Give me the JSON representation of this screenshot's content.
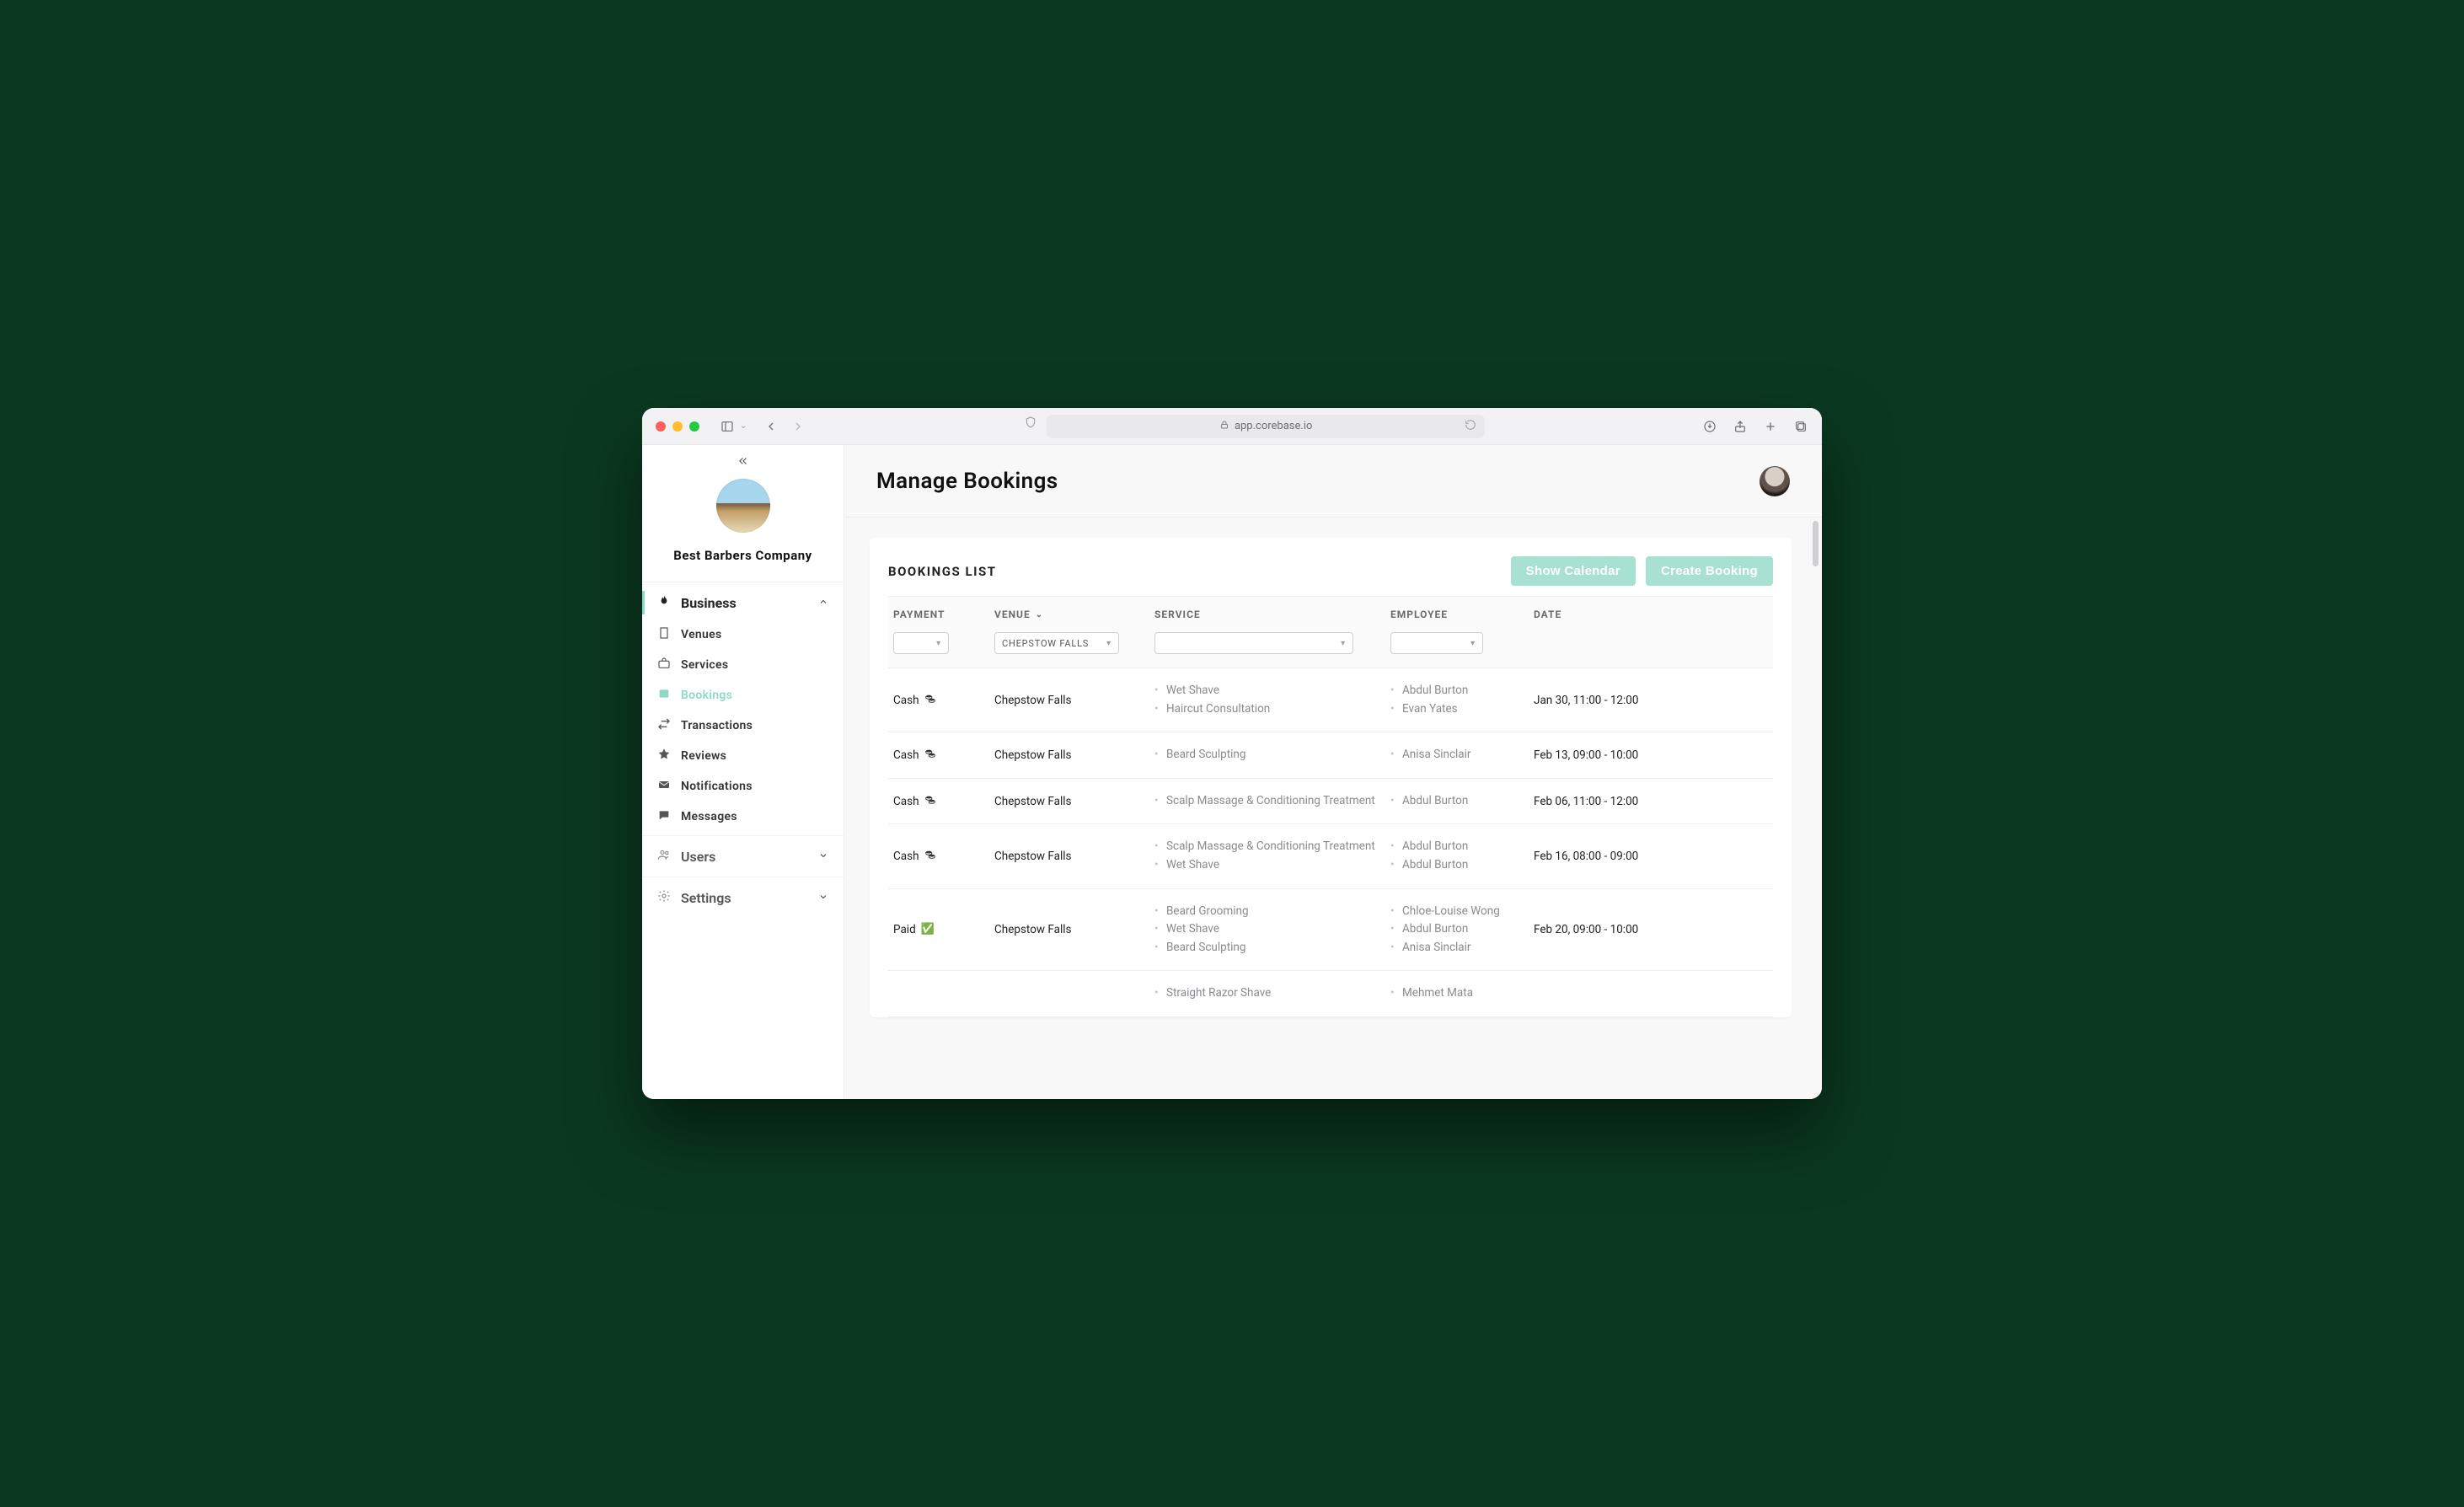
{
  "browser": {
    "url_host": "app.corebase.io"
  },
  "org": {
    "name": "Best Barbers Company"
  },
  "page": {
    "title": "Manage Bookings"
  },
  "sidebar": {
    "parent_business": "Business",
    "items": {
      "venues": "Venues",
      "services": "Services",
      "bookings": "Bookings",
      "transactions": "Transactions",
      "reviews": "Reviews",
      "notifications": "Notifications",
      "messages": "Messages"
    },
    "parent_users": "Users",
    "parent_settings": "Settings"
  },
  "card": {
    "title": "BOOKINGS LIST",
    "btn_calendar": "Show Calendar",
    "btn_create": "Create Booking"
  },
  "columns": {
    "payment": "PAYMENT",
    "venue": "VENUE",
    "service": "SERVICE",
    "employee": "EMPLOYEE",
    "date": "DATE"
  },
  "filters": {
    "venue_selected": "CHEPSTOW FALLS"
  },
  "rows": [
    {
      "payment": "Cash",
      "paid": false,
      "venue": "Chepstow Falls",
      "services": [
        "Wet Shave",
        "Haircut Consultation"
      ],
      "employees": [
        "Abdul Burton",
        "Evan Yates"
      ],
      "date": "Jan 30, 11:00 - 12:00"
    },
    {
      "payment": "Cash",
      "paid": false,
      "venue": "Chepstow Falls",
      "services": [
        "Beard Sculpting"
      ],
      "employees": [
        "Anisa Sinclair"
      ],
      "date": "Feb 13, 09:00 - 10:00"
    },
    {
      "payment": "Cash",
      "paid": false,
      "venue": "Chepstow Falls",
      "services": [
        "Scalp Massage & Conditioning Treatment"
      ],
      "employees": [
        "Abdul Burton"
      ],
      "date": "Feb 06, 11:00 - 12:00"
    },
    {
      "payment": "Cash",
      "paid": false,
      "venue": "Chepstow Falls",
      "services": [
        "Scalp Massage & Conditioning Treatment",
        "Wet Shave"
      ],
      "employees": [
        "Abdul Burton",
        "Abdul Burton"
      ],
      "date": "Feb 16, 08:00 - 09:00"
    },
    {
      "payment": "Paid",
      "paid": true,
      "venue": "Chepstow Falls",
      "services": [
        "Beard Grooming",
        "Wet Shave",
        "Beard Sculpting"
      ],
      "employees": [
        "Chloe-Louise Wong",
        "Abdul Burton",
        "Anisa Sinclair"
      ],
      "date": "Feb 20, 09:00 - 10:00"
    },
    {
      "payment": "",
      "paid": false,
      "venue": "",
      "services": [
        "Straight Razor Shave"
      ],
      "employees": [
        "Mehmet Mata"
      ],
      "date": ""
    }
  ]
}
